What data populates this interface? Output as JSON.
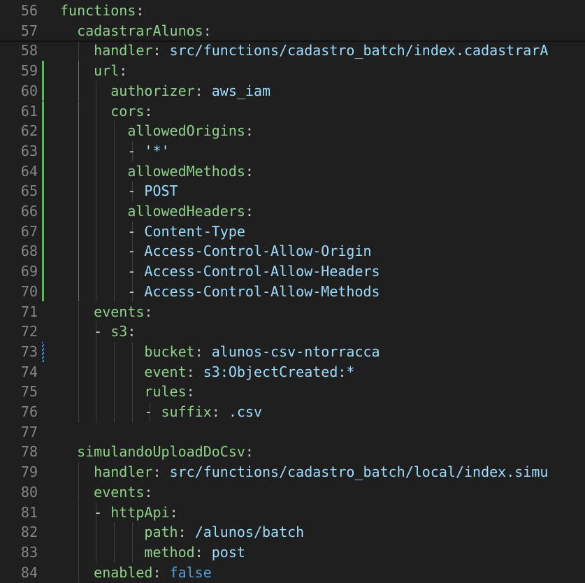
{
  "editor": {
    "lines": [
      {
        "n": "56",
        "key": "functions",
        "sep": ":",
        "val": "",
        "dash": "",
        "depth": 0,
        "mod": "",
        "sticky": true
      },
      {
        "n": "57",
        "key": "cadastrarAlunos",
        "sep": ":",
        "val": "",
        "dash": "",
        "depth": 1,
        "mod": "",
        "sticky": true
      },
      {
        "n": "58",
        "key": "handler",
        "sep": ": ",
        "val": "src/functions/cadastro_batch/index.cadastrarA",
        "dash": "",
        "depth": 2,
        "mod": ""
      },
      {
        "n": "59",
        "key": "url",
        "sep": ":",
        "val": "",
        "dash": "",
        "depth": 2,
        "mod": "added"
      },
      {
        "n": "60",
        "key": "authorizer",
        "sep": ": ",
        "val": "aws_iam",
        "dash": "",
        "depth": 3,
        "mod": "added"
      },
      {
        "n": "61",
        "key": "cors",
        "sep": ":",
        "val": "",
        "dash": "",
        "depth": 3,
        "mod": "added"
      },
      {
        "n": "62",
        "key": "allowedOrigins",
        "sep": ":",
        "val": "",
        "dash": "",
        "depth": 4,
        "mod": "added"
      },
      {
        "n": "63",
        "key": "",
        "sep": "",
        "val": "'*'",
        "dash": "- ",
        "depth": 5,
        "mod": "added"
      },
      {
        "n": "64",
        "key": "allowedMethods",
        "sep": ":",
        "val": "",
        "dash": "",
        "depth": 4,
        "mod": "added"
      },
      {
        "n": "65",
        "key": "",
        "sep": "",
        "val": "POST",
        "dash": "- ",
        "depth": 5,
        "mod": "added"
      },
      {
        "n": "66",
        "key": "allowedHeaders",
        "sep": ":",
        "val": "",
        "dash": "",
        "depth": 4,
        "mod": "added"
      },
      {
        "n": "67",
        "key": "",
        "sep": "",
        "val": "Content-Type",
        "dash": "- ",
        "depth": 5,
        "mod": "added"
      },
      {
        "n": "68",
        "key": "",
        "sep": "",
        "val": "Access-Control-Allow-Origin",
        "dash": "- ",
        "depth": 5,
        "mod": "added"
      },
      {
        "n": "69",
        "key": "",
        "sep": "",
        "val": "Access-Control-Allow-Headers",
        "dash": "- ",
        "depth": 5,
        "mod": "added"
      },
      {
        "n": "70",
        "key": "",
        "sep": "",
        "val": "Access-Control-Allow-Methods",
        "dash": "- ",
        "depth": 5,
        "mod": "added"
      },
      {
        "n": "71",
        "key": "events",
        "sep": ":",
        "val": "",
        "dash": "",
        "depth": 2,
        "mod": ""
      },
      {
        "n": "72",
        "key": "s3",
        "sep": ":",
        "val": "",
        "dash": "- ",
        "depth": 3,
        "mod": ""
      },
      {
        "n": "73",
        "key": "bucket",
        "sep": ": ",
        "val": "alunos-csv-ntorracca",
        "dash": "",
        "depth": 5,
        "mod": "modified"
      },
      {
        "n": "74",
        "key": "event",
        "sep": ": ",
        "val": "s3:ObjectCreated:*",
        "dash": "",
        "depth": 5,
        "mod": ""
      },
      {
        "n": "75",
        "key": "rules",
        "sep": ":",
        "val": "",
        "dash": "",
        "depth": 5,
        "mod": ""
      },
      {
        "n": "76",
        "key": "suffix",
        "sep": ": ",
        "val": ".csv",
        "dash": "- ",
        "depth": 6,
        "mod": ""
      },
      {
        "n": "77",
        "key": "",
        "sep": "",
        "val": "",
        "dash": "",
        "depth": 0,
        "mod": ""
      },
      {
        "n": "78",
        "key": "simulandoUploadDoCsv",
        "sep": ":",
        "val": "",
        "dash": "",
        "depth": 1,
        "mod": ""
      },
      {
        "n": "79",
        "key": "handler",
        "sep": ": ",
        "val": "src/functions/cadastro_batch/local/index.simu",
        "dash": "",
        "depth": 2,
        "mod": ""
      },
      {
        "n": "80",
        "key": "events",
        "sep": ":",
        "val": "",
        "dash": "",
        "depth": 2,
        "mod": ""
      },
      {
        "n": "81",
        "key": "httpApi",
        "sep": ":",
        "val": "",
        "dash": "- ",
        "depth": 3,
        "mod": ""
      },
      {
        "n": "82",
        "key": "path",
        "sep": ": ",
        "val": "/alunos/batch",
        "dash": "",
        "depth": 5,
        "mod": ""
      },
      {
        "n": "83",
        "key": "method",
        "sep": ": ",
        "val": "post",
        "dash": "",
        "depth": 5,
        "mod": ""
      },
      {
        "n": "84",
        "key": "enabled",
        "sep": ": ",
        "val": "false",
        "dash": "",
        "depth": 2,
        "mod": "",
        "bool": true
      }
    ]
  },
  "colors": {
    "background": "#1f1f1f",
    "key": "#8fd18a",
    "value": "#9cdcfe",
    "boolean": "#569cd6",
    "line_number": "#858585",
    "added_gutter": "#5cb85c",
    "modified_gutter": "#3b8eea"
  }
}
